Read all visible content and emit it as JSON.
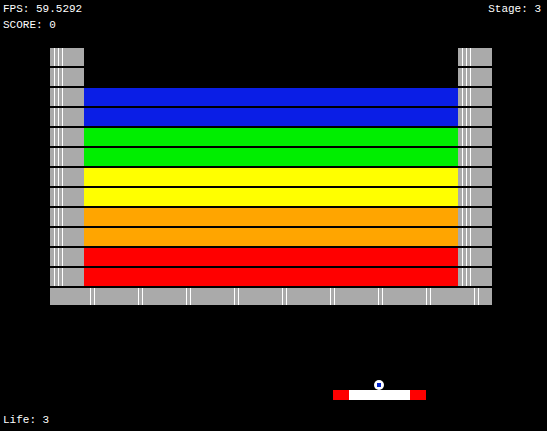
{
  "hud": {
    "fps": "FPS: 59.5292",
    "score": "SCORE: 0",
    "stage": "Stage: 3",
    "life": "Life: 3"
  },
  "rows": [
    {
      "kind": "empty"
    },
    {
      "kind": "empty"
    },
    {
      "kind": "brick",
      "color": "#0a1ee6"
    },
    {
      "kind": "brick",
      "color": "#0a1ee6"
    },
    {
      "kind": "brick",
      "color": "#00ee00"
    },
    {
      "kind": "brick",
      "color": "#00ee00"
    },
    {
      "kind": "brick",
      "color": "#ffff00"
    },
    {
      "kind": "brick",
      "color": "#ffff00"
    },
    {
      "kind": "brick",
      "color": "#ffa500"
    },
    {
      "kind": "brick",
      "color": "#ffa500"
    },
    {
      "kind": "brick",
      "color": "#ff0000"
    },
    {
      "kind": "brick",
      "color": "#ff0000"
    }
  ]
}
